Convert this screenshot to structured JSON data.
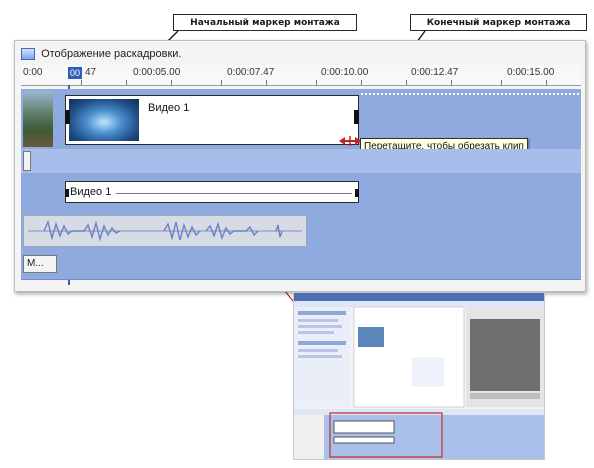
{
  "callouts": {
    "start_marker": "Начальный маркер монтажа",
    "end_marker": "Конечный маркер монтажа"
  },
  "timeline": {
    "view_label": "Отображение раскадровки.",
    "ruler_ticks": [
      "0:00",
      "00",
      "47",
      "0:00:05.00",
      "0:00:07.47",
      "0:00:10.00",
      "0:00:12.47",
      "0:00:15.00"
    ],
    "icons": {
      "storyboard": "storyboard-icon",
      "trim_handle": "trim-arrows-icon"
    },
    "colors": {
      "track_bg": "#8eaadf",
      "playhead": "#2e5fb8",
      "trim_handle": "#cc2020"
    }
  },
  "clips": {
    "video_title": "Видео 1",
    "title_track_label": "Видео 1"
  },
  "music_track_label": "М...",
  "tooltip": "Перетащите, чтобы обрезать клип"
}
